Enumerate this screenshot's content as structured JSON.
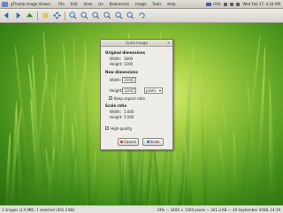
{
  "app": {
    "title": "gThumb Image Viewer",
    "window_title": "Scale Image"
  },
  "menu": [
    "File",
    "Edit",
    "View",
    "Go",
    "Bookmarks",
    "Image",
    "Tools",
    "Help"
  ],
  "tray": {
    "lang": "USA",
    "clock": "Wed Feb 17, 4:24 AM"
  },
  "toolbar_icons": [
    "back-icon",
    "forward-icon",
    "up-icon",
    "bookmark-icon",
    "move-icon",
    "zoom-in-icon",
    "zoom-out-icon",
    "zoom-100-icon",
    "zoom-fit-icon",
    "zoom-width-icon",
    "zoom-height-icon",
    "rotate-icon"
  ],
  "dialog": {
    "title": "Scale Image",
    "original_heading": "Original dimensions",
    "original_width_label": "Width:",
    "original_width": "1600",
    "original_height_label": "Height:",
    "original_height": "1200",
    "new_heading": "New dimensions",
    "width_label": "Width:",
    "width_value": "1600",
    "height_label": "Height:",
    "height_value": "1200",
    "unit": "pixels",
    "keep_ratio_label": "Keep aspect ratio",
    "ratio_heading": "Scale ratio",
    "ratio_width_label": "Width:",
    "ratio_width": "1.000",
    "ratio_height_label": "Height:",
    "ratio_height": "1.000",
    "high_quality_label": "High quality",
    "cancel_label": "Cancel",
    "scale_label": "Scale"
  },
  "status": {
    "left": "1 images (2.0 MB), 1 selected (301.3 KB)",
    "right": "33% — 1600 × 1200 pixels — 301.3 KB — 29 September 2008, 14:19"
  }
}
